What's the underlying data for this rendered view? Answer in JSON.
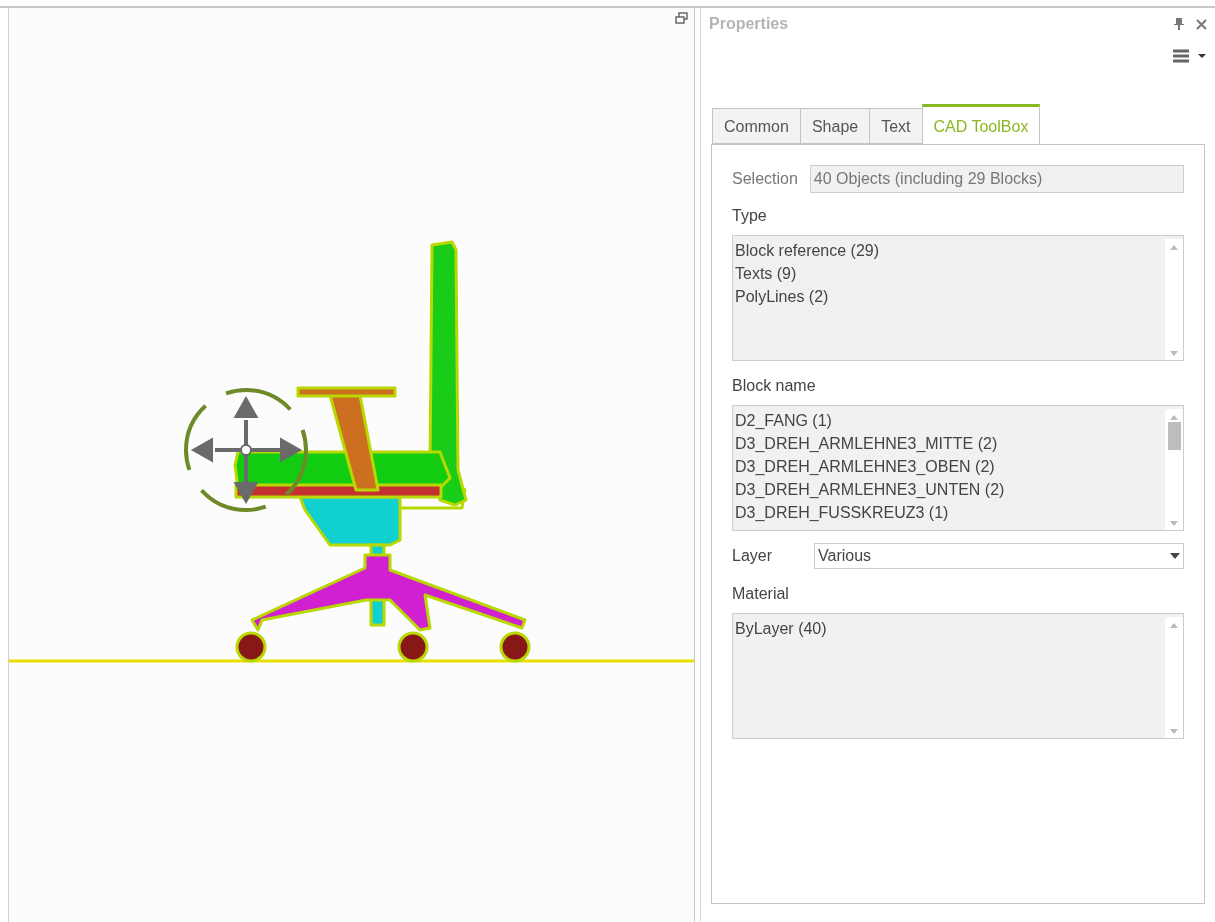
{
  "panel": {
    "title": "Properties"
  },
  "tabs": [
    {
      "label": "Common",
      "selected": false
    },
    {
      "label": "Shape",
      "selected": false
    },
    {
      "label": "Text",
      "selected": false
    },
    {
      "label": "CAD ToolBox",
      "selected": true
    }
  ],
  "selection": {
    "label": "Selection",
    "value": "40 Objects (including 29 Blocks)"
  },
  "type": {
    "label": "Type",
    "items": [
      "Block reference (29)",
      "Texts (9)",
      "PolyLines (2)"
    ]
  },
  "block_name": {
    "label": "Block name",
    "items": [
      "D2_FANG (1)",
      "D3_DREH_ARMLEHNE3_MITTE (2)",
      "D3_DREH_ARMLEHNE3_OBEN (2)",
      "D3_DREH_ARMLEHNE3_UNTEN (2)",
      "D3_DREH_FUSSKREUZ3 (1)"
    ]
  },
  "layer": {
    "label": "Layer",
    "value": "Various"
  },
  "material": {
    "label": "Material",
    "items": [
      "ByLayer (40)"
    ]
  }
}
